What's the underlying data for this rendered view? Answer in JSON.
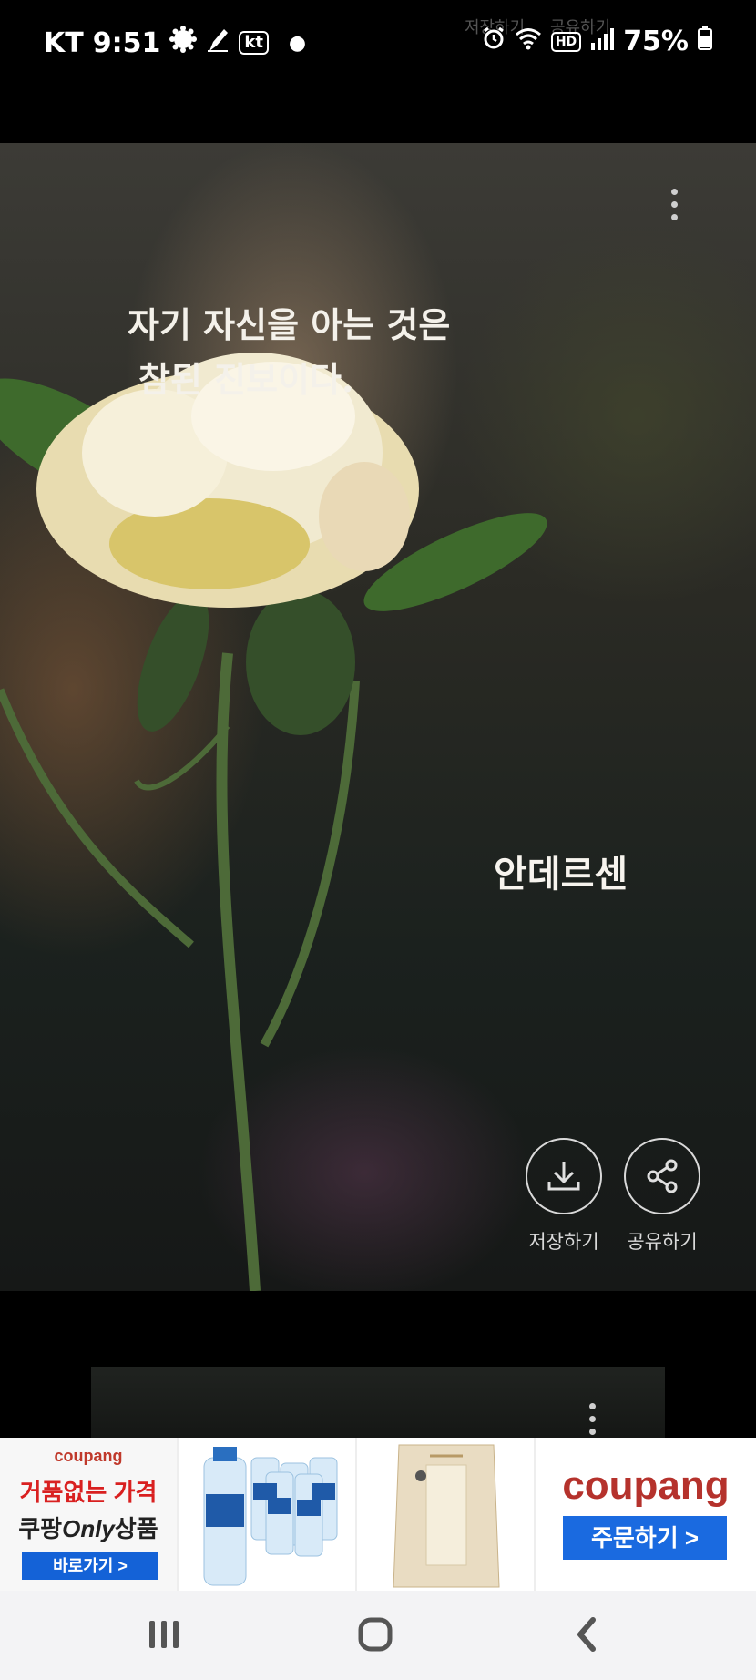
{
  "status_bar": {
    "carrier": "KT",
    "time": "9:51",
    "carrier_badge": "kt",
    "hd_badge": "HD",
    "battery": "75%",
    "ghost_save": "저장하기",
    "ghost_share": "공유하기"
  },
  "card": {
    "quote_line1": "자기 자신을 아는 것은",
    "quote_line2": "참된 진보이다.",
    "author": "안데르센",
    "save_label": "저장하기",
    "share_label": "공유하기"
  },
  "ad": {
    "brand_small": "coupang",
    "headline1": "거품없는 가격",
    "headline2_a": "쿠팡",
    "headline2_b": "Only",
    "headline2_c": "상품",
    "cta_small": "바로가기 >",
    "brand_large": "coupang",
    "cta_order": "주문하기 >",
    "colors": {
      "cta_blue": "#1462d7",
      "headline_red": "#d92020"
    }
  },
  "icons": [
    "brightness-icon",
    "pen-icon",
    "dot-icon",
    "alarm-icon",
    "wifi-icon",
    "signal-icon",
    "battery-icon",
    "kebab-icon",
    "download-icon",
    "share-icon",
    "recents-icon",
    "home-icon",
    "back-icon"
  ]
}
